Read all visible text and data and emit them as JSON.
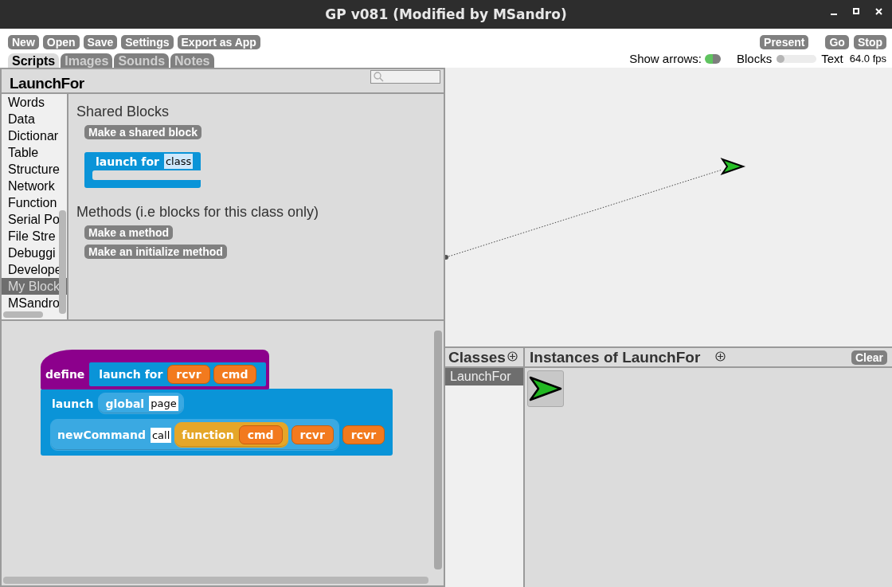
{
  "window": {
    "title": "GP v081 (Modified by MSandro)"
  },
  "toolbar": {
    "buttons": [
      "New",
      "Open",
      "Save",
      "Settings",
      "Export as App"
    ],
    "right_buttons": [
      "Present",
      "Go",
      "Stop"
    ]
  },
  "tabs": [
    {
      "label": "Scripts",
      "selected": true
    },
    {
      "label": "Images",
      "selected": false
    },
    {
      "label": "Sounds",
      "selected": false
    },
    {
      "label": "Notes",
      "selected": false
    }
  ],
  "show_arrows": {
    "label": "Show arrows:",
    "on": true
  },
  "view_slider": {
    "left_label": "Blocks",
    "right_label": "Text",
    "level": 0.1
  },
  "fps": "64.0 fps",
  "palette_header": {
    "title": "LaunchFor"
  },
  "categories": [
    {
      "label": "Words",
      "selected": false
    },
    {
      "label": "Data",
      "selected": false
    },
    {
      "label": "Dictionar",
      "selected": false
    },
    {
      "label": "Table",
      "selected": false
    },
    {
      "label": "Structure",
      "selected": false
    },
    {
      "label": "Network",
      "selected": false
    },
    {
      "label": "Function",
      "selected": false
    },
    {
      "label": "Serial Po",
      "selected": false
    },
    {
      "label": "File Stre",
      "selected": false
    },
    {
      "label": "Debuggi",
      "selected": false
    },
    {
      "label": "Develope",
      "selected": false
    },
    {
      "label": "My Block",
      "selected": true
    },
    {
      "label": "MSandro",
      "selected": false
    }
  ],
  "palette": {
    "shared_heading": "Shared Blocks",
    "shared_button": "Make a shared block",
    "shared_block": {
      "color": "#0a94d8",
      "parts": [
        {
          "kind": "label",
          "text": "launch for"
        },
        {
          "kind": "slot",
          "text": "class"
        }
      ]
    },
    "methods_heading": "Methods (i.e blocks for this class only)",
    "method_buttons": [
      "Make a method",
      "Make an initialize method"
    ]
  },
  "script": {
    "hat_label": "define",
    "prototype": {
      "color": "#0a94d8",
      "parts": [
        {
          "kind": "label",
          "text": "launch for"
        },
        {
          "kind": "var",
          "text": "rcvr"
        },
        {
          "kind": "var",
          "text": "cmd"
        }
      ]
    },
    "body": {
      "color": "#0a94d8",
      "rows": [
        {
          "parts": [
            {
              "kind": "label",
              "text": "launch"
            },
            {
              "kind": "reporter",
              "color": "#3aa9e2",
              "parts": [
                {
                  "kind": "label",
                  "text": "global"
                },
                {
                  "kind": "slot",
                  "text": "page"
                }
              ]
            }
          ]
        },
        {
          "parts": [
            {
              "kind": "reporter",
              "color": "#3aa9e2",
              "parts": [
                {
                  "kind": "label",
                  "text": "newCommand"
                },
                {
                  "kind": "slot",
                  "text": "call"
                },
                {
                  "kind": "reporter",
                  "color": "#e5a628",
                  "parts": [
                    {
                      "kind": "label",
                      "text": "function"
                    },
                    {
                      "kind": "var",
                      "text": "cmd"
                    }
                  ]
                },
                {
                  "kind": "var",
                  "text": "rcvr"
                }
              ]
            },
            {
              "kind": "var",
              "text": "rcvr"
            }
          ]
        }
      ]
    }
  },
  "classes": {
    "title": "Classes",
    "items": [
      {
        "label": "LaunchFor",
        "selected": true
      }
    ]
  },
  "instances": {
    "title": "Instances of LaunchFor",
    "clear": "Clear"
  }
}
